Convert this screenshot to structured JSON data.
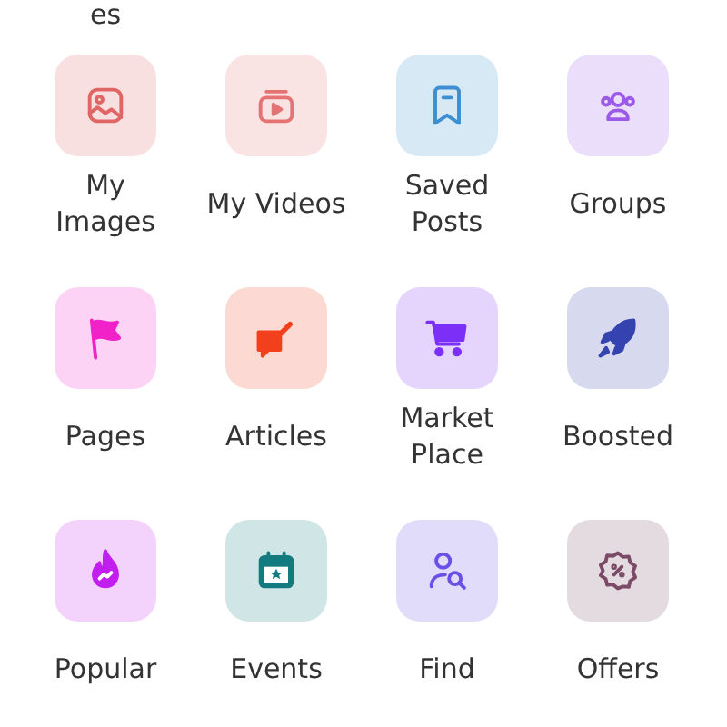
{
  "cut_label": "es",
  "items": [
    {
      "label": "My Images",
      "kind": "images",
      "color": "#e06666"
    },
    {
      "label": "My Videos",
      "kind": "videos",
      "color": "#e57373"
    },
    {
      "label": "Saved Posts",
      "kind": "saved",
      "color": "#3d8fd1"
    },
    {
      "label": "Groups",
      "kind": "groups",
      "color": "#9b59e8"
    },
    {
      "label": "Pages",
      "kind": "pages",
      "color": "#f022c8"
    },
    {
      "label": "Articles",
      "kind": "articles",
      "color": "#f2401c"
    },
    {
      "label": "Market Place",
      "kind": "market",
      "color": "#7b2ff7"
    },
    {
      "label": "Boosted",
      "kind": "boosted",
      "color": "#3543b0"
    },
    {
      "label": "Popular",
      "kind": "popular",
      "color": "#c21ef0"
    },
    {
      "label": "Events",
      "kind": "events",
      "color": "#137b80"
    },
    {
      "label": "Find",
      "kind": "find",
      "color": "#6b4fe6"
    },
    {
      "label": "Offers",
      "kind": "offers",
      "color": "#7a4a66"
    }
  ]
}
